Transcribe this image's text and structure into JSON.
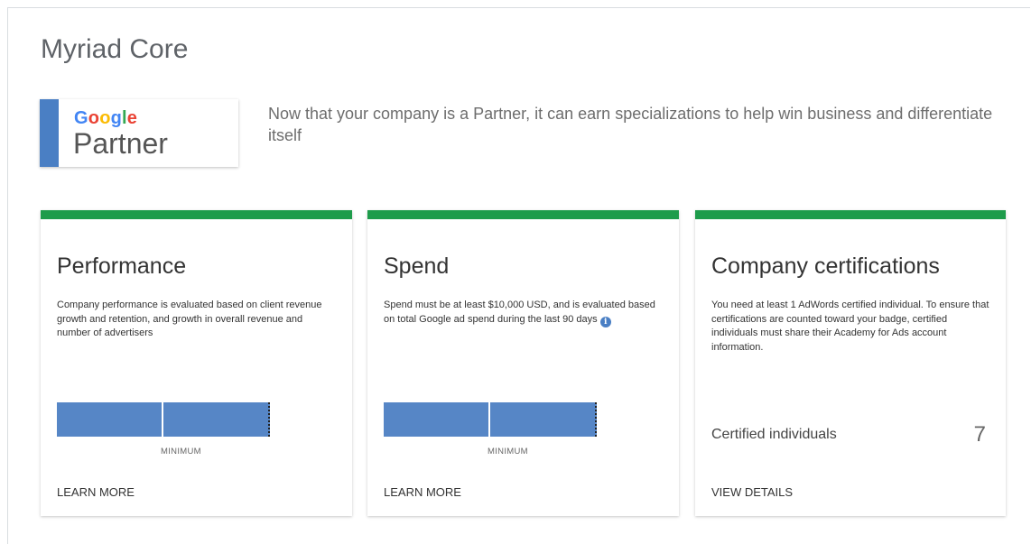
{
  "page": {
    "title": "Myriad Core",
    "intro": "Now that your company is a Partner, it can earn specializations to help win business and differentiate itself"
  },
  "badge": {
    "google_letters": [
      "G",
      "o",
      "o",
      "g",
      "l",
      "e"
    ],
    "partner_text": "Partner",
    "colors": {
      "bar": "#4a7fc4",
      "google_blue": "#4285f4",
      "google_red": "#ea4335",
      "google_yellow": "#fbbc05",
      "google_green": "#34a853"
    }
  },
  "cards": {
    "performance": {
      "title": "Performance",
      "description": "Company performance is evaluated based on client revenue growth and retention, and growth in overall revenue and number of advertisers",
      "progress_fraction": 1.0,
      "bar_caption": "MINIMUM",
      "link": "LEARN MORE"
    },
    "spend": {
      "title": "Spend",
      "description": "Spend must be at least $10,000 USD, and is evaluated based on total Google ad spend during the last 90 days",
      "info_icon": "info-icon",
      "progress_fraction": 1.0,
      "bar_caption": "MINIMUM",
      "link": "LEARN MORE"
    },
    "certifications": {
      "title": "Company certifications",
      "description": "You need at least 1 AdWords certified individual. To ensure that certifications are counted toward your badge, certified individuals must share their Academy for Ads account information.",
      "row_label": "Certified individuals",
      "row_value": "7",
      "link": "VIEW DETAILS"
    }
  },
  "colors": {
    "accent_green": "#1e9c4b",
    "bar_blue": "#5686c6"
  }
}
